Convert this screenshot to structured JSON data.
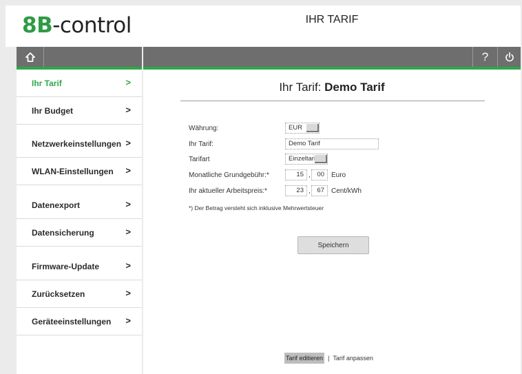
{
  "header": {
    "logo_prefix": "8B",
    "logo_text": "-control",
    "page_heading": "IHR TARIF"
  },
  "toolbar": {
    "home_icon": "home-icon",
    "help_label": "?",
    "power_icon": "power-icon"
  },
  "sidebar": {
    "items": [
      {
        "label": "Ihr Tarif",
        "active": true
      },
      {
        "label": "Ihr Budget",
        "active": false
      },
      {
        "label": "Netzwerkeinstellungen",
        "active": false
      },
      {
        "label": "WLAN-Einstellungen",
        "active": false
      },
      {
        "label": "Datenexport",
        "active": false
      },
      {
        "label": "Datensicherung",
        "active": false
      },
      {
        "label": "Firmware-Update",
        "active": false
      },
      {
        "label": "Zurücksetzen",
        "active": false
      },
      {
        "label": "Geräteeinstellungen",
        "active": false
      }
    ],
    "chevron": ">"
  },
  "main": {
    "title_prefix": "Ihr Tarif: ",
    "title_name": "Demo Tarif",
    "form": {
      "currency_label": "Währung:",
      "currency_value": "EUR",
      "tariff_label": "Ihr Tarif:",
      "tariff_value": "Demo Tarif",
      "tariff_type_label": "Tarifart",
      "tariff_type_value": "Einzeltarif",
      "base_fee_label": "Monatliche Grundgebühr:*",
      "base_fee_int": "15",
      "base_fee_dec": "00",
      "base_fee_unit": "Euro",
      "work_price_label": "Ihr aktueller Arbeitspreis:*",
      "work_price_int": "23",
      "work_price_dec": "67",
      "work_price_unit": "Cent/kWh",
      "comma": ","
    },
    "footnote": "*) Der Betrag versteht sich inklusive Mehrwertsteuer",
    "save_label": "Speichern"
  },
  "bottom_links": {
    "edit": "Tarif editieren",
    "separator": "|",
    "adjust": "Tarif anpassen"
  },
  "colors": {
    "accent": "#2ea84a",
    "toolbar": "#6e6e6e",
    "background": "#ebebeb"
  }
}
